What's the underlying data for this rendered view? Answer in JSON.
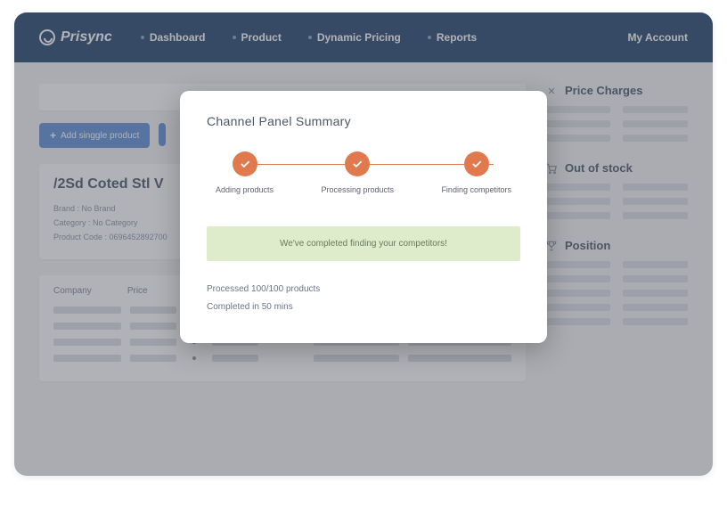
{
  "brand": "Prisync",
  "nav": {
    "dashboard": "Dashboard",
    "product": "Product",
    "dynamic_pricing": "Dynamic Pricing",
    "reports": "Reports",
    "account": "My Account"
  },
  "buttons": {
    "add_product": "Add singgle product"
  },
  "product": {
    "title": "/2Sd Coted Stl V",
    "brand_line": "Brand : No Brand",
    "category_line": "Category : No Category",
    "code_line": "Product Code : 0696452892700"
  },
  "table": {
    "col_company": "Company",
    "col_price": "Price"
  },
  "sidebar": {
    "price_charges": "Price Charges",
    "out_of_stock": "Out of stock",
    "position": "Position"
  },
  "modal": {
    "title": "Channel Panel Summary",
    "step1": "Adding products",
    "step2": "Processing products",
    "step3": "Finding competitors",
    "success": "We've completed finding your competitors!",
    "processed": "Processed 100/100 products",
    "completed": "Completed in 50 mins"
  }
}
